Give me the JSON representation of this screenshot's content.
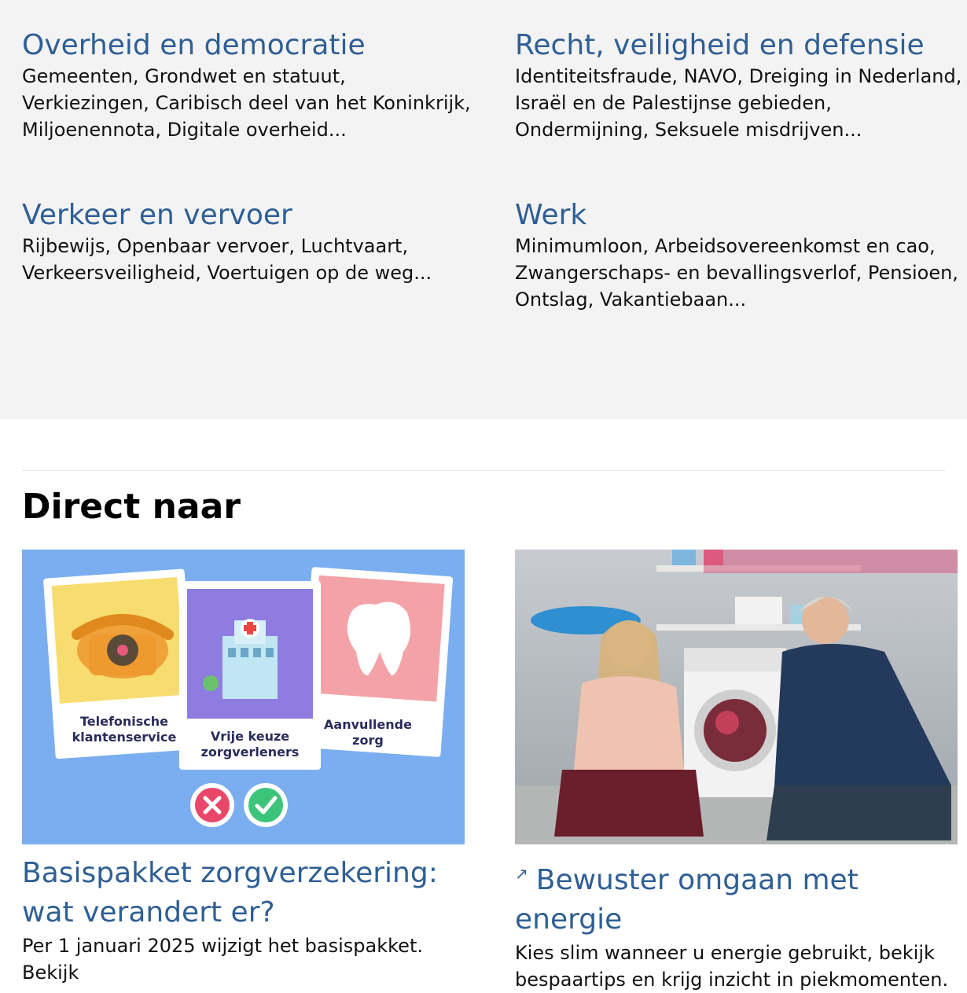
{
  "topics": [
    {
      "title": "Overheid en democratie",
      "desc": "Gemeenten, Grondwet en statuut, Verkiezingen, Caribisch deel van het Koninkrijk, Miljoenennota, Digitale overheid..."
    },
    {
      "title": "Recht, veiligheid en defensie",
      "desc": "Identiteitsfraude, NAVO, Dreiging in Nederland, Israël en de Palestijnse gebieden, Ondermijning, Seksuele misdrijven..."
    },
    {
      "title": "Verkeer en vervoer",
      "desc": "Rijbewijs, Openbaar vervoer, Luchtvaart, Verkeersveiligheid, Voertuigen op de weg..."
    },
    {
      "title": "Werk",
      "desc": "Minimumloon, Arbeidsovereenkomst en cao, Zwangerschaps- en bevallingsverlof, Pensioen, Ontslag, Vakantiebaan..."
    }
  ],
  "direct": {
    "heading": "Direct naar",
    "cards": [
      {
        "title": "Basispakket zorgverzekering: wat verandert er?",
        "desc": "Per 1 januari 2025 wijzigt het basispakket. Bekijk",
        "illustration": {
          "labels": [
            "Telefonische",
            "klantenservice",
            "Vrije keuze",
            "zorgverleners",
            "Aanvullende",
            "zorg"
          ]
        }
      },
      {
        "title": "Bewuster omgaan met energie",
        "external_icon": "↗",
        "desc": "Kies slim wanneer u energie gebruikt, bekijk bespaartips en krijg inzicht in piekmomenten."
      }
    ]
  },
  "colors": {
    "link": "#2f5f94",
    "band": "#f3f3f3",
    "illustration_bg": "#7aaef0"
  }
}
